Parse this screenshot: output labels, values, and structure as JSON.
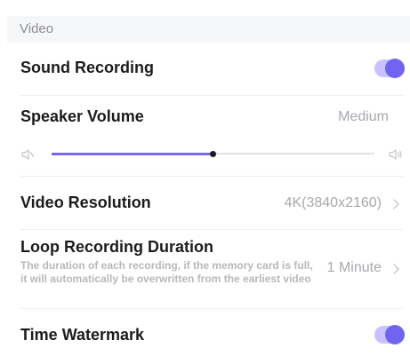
{
  "section": {
    "title": "Video"
  },
  "rows": {
    "sound_recording": {
      "title": "Sound Recording",
      "enabled": true
    },
    "speaker_volume": {
      "title": "Speaker Volume",
      "value": "Medium",
      "level": 0.5
    },
    "video_resolution": {
      "title": "Video Resolution",
      "value": "4K(3840x2160)"
    },
    "loop_recording": {
      "title": "Loop Recording Duration",
      "description": "The duration of each recording, if the memory card is full, it will automatically be overwritten from the earliest video",
      "value": "1 Minute"
    },
    "time_watermark": {
      "title": "Time Watermark",
      "enabled": true
    }
  },
  "colors": {
    "accent": "#7164f0",
    "accent_light": "#c9c2ff",
    "title_text": "#1c1c1e",
    "secondary_text": "#a8a8ae",
    "section_background": "#f5f6f8"
  },
  "icons": {
    "volume_low": "speaker-muted-icon",
    "volume_high": "speaker-loud-icon",
    "chevron": "chevron-right-icon"
  }
}
